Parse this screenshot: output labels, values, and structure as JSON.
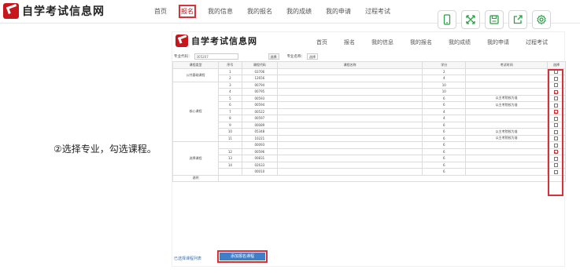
{
  "header": {
    "logo_text": "自学考试信息网",
    "nav": [
      "首页",
      "报名",
      "我的信息",
      "我的报名",
      "我的成绩",
      "我的申请",
      "过程考试"
    ]
  },
  "toolbar": {
    "icons": [
      "phone-icon",
      "expand-icon",
      "save-icon",
      "share-icon",
      "settings-icon"
    ],
    "accent": "#2aa146"
  },
  "caption": "②选择专业，勾选课程。",
  "inner": {
    "logo_text": "自学考试信息网",
    "nav": [
      "首页",
      "报名",
      "我的信息",
      "我的报名",
      "我的成绩",
      "我的申请",
      "过程考试"
    ],
    "filter": {
      "code_label": "专业代码：",
      "code_value": "305207",
      "query_button": "选择",
      "name_label": "专业名称：",
      "name_value": "选择"
    },
    "table": {
      "headers": [
        "课程类型",
        "序号",
        "课程代码",
        "课程名称",
        "学分",
        "考试时间",
        "选择"
      ],
      "groups": [
        {
          "type": "公共基础课程",
          "rows": [
            {
              "seq": "1",
              "code": "03706",
              "credit": "2",
              "time": "",
              "checked": false
            },
            {
              "seq": "2",
              "code": "12656",
              "credit": "4",
              "time": "",
              "checked": false
            }
          ]
        },
        {
          "type": "核心课程",
          "rows": [
            {
              "seq": "3",
              "code": "00794",
              "credit": "10",
              "time": "",
              "checked": false
            },
            {
              "seq": "4",
              "code": "00795",
              "credit": "10",
              "time": "",
              "checked": true
            },
            {
              "seq": "5",
              "code": "00593",
              "credit": "6",
              "time": "以主考院校为准",
              "checked": false
            },
            {
              "seq": "6",
              "code": "00594",
              "credit": "6",
              "time": "以主考院校为准",
              "checked": false
            },
            {
              "seq": "7",
              "code": "00522",
              "credit": "4",
              "time": "",
              "checked": true
            },
            {
              "seq": "8",
              "code": "00597",
              "credit": "4",
              "time": "",
              "checked": false
            },
            {
              "seq": "9",
              "code": "00089",
              "credit": "6",
              "time": "",
              "checked": false
            },
            {
              "seq": "10",
              "code": "05348",
              "credit": "6",
              "time": "以主考院校为准",
              "checked": false
            },
            {
              "seq": "11",
              "code": "10221",
              "credit": "6",
              "time": "以主考院校为准",
              "checked": false
            }
          ]
        },
        {
          "type": "选择课程",
          "rows": [
            {
              "seq": "",
              "code": "00093",
              "credit": "6",
              "time": "",
              "checked": false
            },
            {
              "seq": "12",
              "code": "00596",
              "credit": "6",
              "time": "",
              "checked": true
            },
            {
              "seq": "13",
              "code": "00831",
              "credit": "6",
              "time": "",
              "checked": false
            },
            {
              "seq": "14",
              "code": "02633",
              "credit": "6",
              "time": "",
              "checked": false
            },
            {
              "seq": "",
              "code": "00010",
              "credit": "6",
              "time": "",
              "checked": false
            }
          ]
        }
      ],
      "note_label": "说明"
    },
    "bottom_link": "已选择课程列表",
    "submit_button": "添加报名课程"
  }
}
